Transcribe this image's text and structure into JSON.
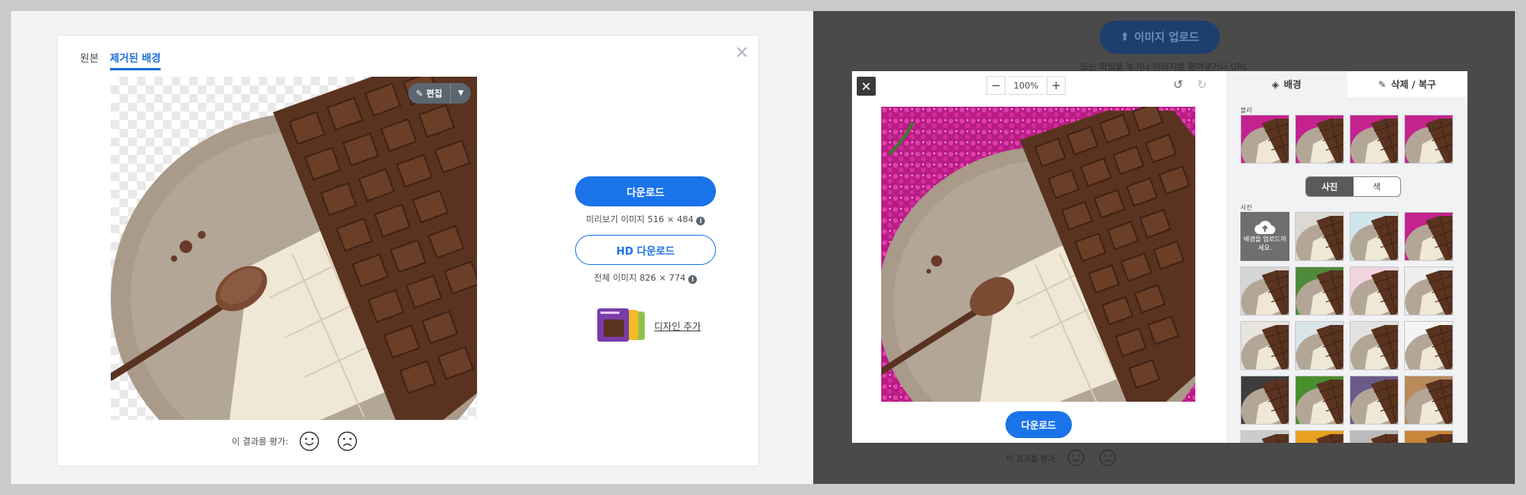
{
  "left": {
    "tabs": [
      "원본",
      "제거된 배경"
    ],
    "active_tab": 1,
    "close_label": "✕",
    "edit_label": "편집",
    "rate_label": "이 결과를 평가:",
    "download_label": "다운로드",
    "preview_caption": "미리보기 이미지 516 × 484",
    "hd_download_label": "HD 다운로드",
    "full_caption": "전체 이미지 826 × 774",
    "design_add_label": "디자인 추가",
    "info_glyph": "i"
  },
  "right": {
    "upload_label": "이미지 업로드",
    "upload_hint": "또는 파일을 놓거나 이미지를 붙여넣거나 URL",
    "rate_label": "이 결과를 평가:",
    "modal": {
      "close_label": "✕",
      "zoom_minus": "−",
      "zoom_value": "100%",
      "zoom_plus": "+",
      "download_label": "다운로드",
      "side_tabs": [
        "배경",
        "삭제 / 복구"
      ],
      "blur_label": "블러",
      "toggle_photo": "사진",
      "toggle_color": "색",
      "photo_label": "사진",
      "upload_bg_label": "배경을 업로드하세요."
    }
  },
  "colors": {
    "accent": "#1a73e8",
    "flower_pink": "#c4228f",
    "chocolate": "#5a3320",
    "white_choc": "#efe8d6",
    "plate": "#a99a8a"
  },
  "thumbs_photo": [
    [
      "upload",
      "#dcd9d4",
      "#cfe6ec",
      "#c4228f"
    ],
    [
      "#d6d6d6",
      "#4f8a3a",
      "#f2d5e0",
      "#eeeeee"
    ],
    [
      "#e8e4de",
      "#d9e4e8",
      "#e2e2e2",
      "#f4f4f4"
    ],
    [
      "#3d3d3d",
      "#4a8f2e",
      "#6a5a8a",
      "#b98a5a"
    ],
    [
      "#cccccc",
      "#e8a020",
      "#bbbbbb",
      "#c8863a"
    ]
  ],
  "thumbs_blur": [
    "#c4228f",
    "#c4228f",
    "#c4228f",
    "#c4228f"
  ]
}
